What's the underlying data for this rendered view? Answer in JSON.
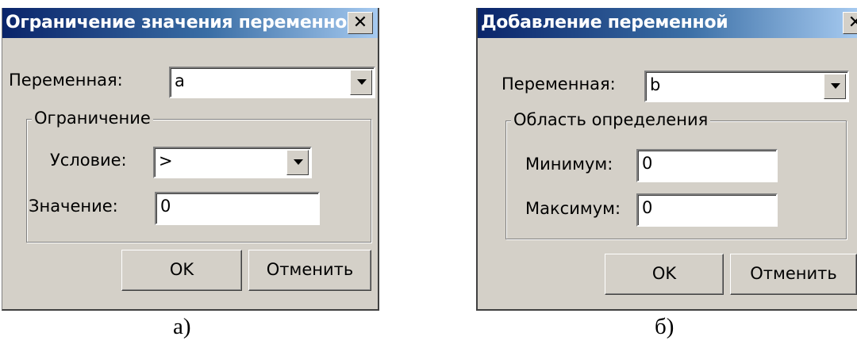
{
  "dialog_a": {
    "title": "Ограничение значения переменной",
    "close": "✕",
    "variable_label": "Переменная:",
    "variable_value": "a",
    "group_label": "Ограничение",
    "condition_label": "Условие:",
    "condition_value": ">",
    "value_label": "Значение:",
    "value_value": "0",
    "ok_label": "OK",
    "cancel_label": "Отменить"
  },
  "dialog_b": {
    "title": "Добавление переменной",
    "close": "✕",
    "variable_label": "Переменная:",
    "variable_value": "b",
    "group_label": "Область определения",
    "min_label": "Минимум:",
    "min_value": "0",
    "max_label": "Максимум:",
    "max_value": "0",
    "ok_label": "OK",
    "cancel_label": "Отменить"
  },
  "captions": {
    "a": "а)",
    "b": "б)"
  }
}
